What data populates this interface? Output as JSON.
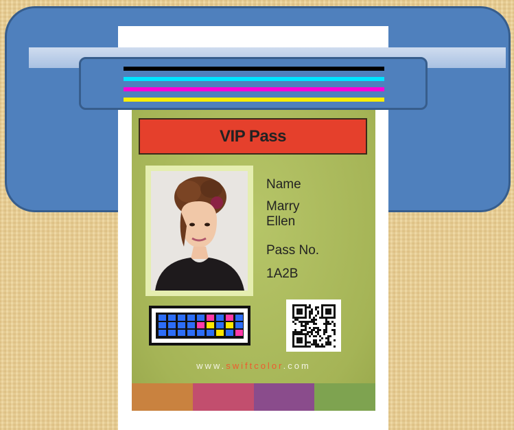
{
  "card": {
    "title": "VIP Pass",
    "name_label": "Name",
    "name_line1": "Marry",
    "name_line2": "Ellen",
    "pass_label": "Pass No.",
    "pass_value": "1A2B",
    "website_prefix": "www.",
    "website_brand": "swiftcolor",
    "website_suffix": ".com"
  },
  "colors": {
    "printer_blue": "#4f80bd",
    "banner_red": "#e5402c",
    "card_green": "#abbb5a",
    "ink_black": "#000000",
    "ink_cyan": "#00e5ff",
    "ink_magenta": "#ff00d8",
    "ink_yellow": "#ffee00",
    "swatches": [
      "#c9823f",
      "#c24e6e",
      "#8a4c8c",
      "#7ea350"
    ]
  },
  "icons": {
    "printer": "printer-icon",
    "print_head": "print-head-icon",
    "color_test_strip": "color-test-strip-icon",
    "qr_code": "qr-code-icon",
    "portrait": "portrait-photo"
  }
}
